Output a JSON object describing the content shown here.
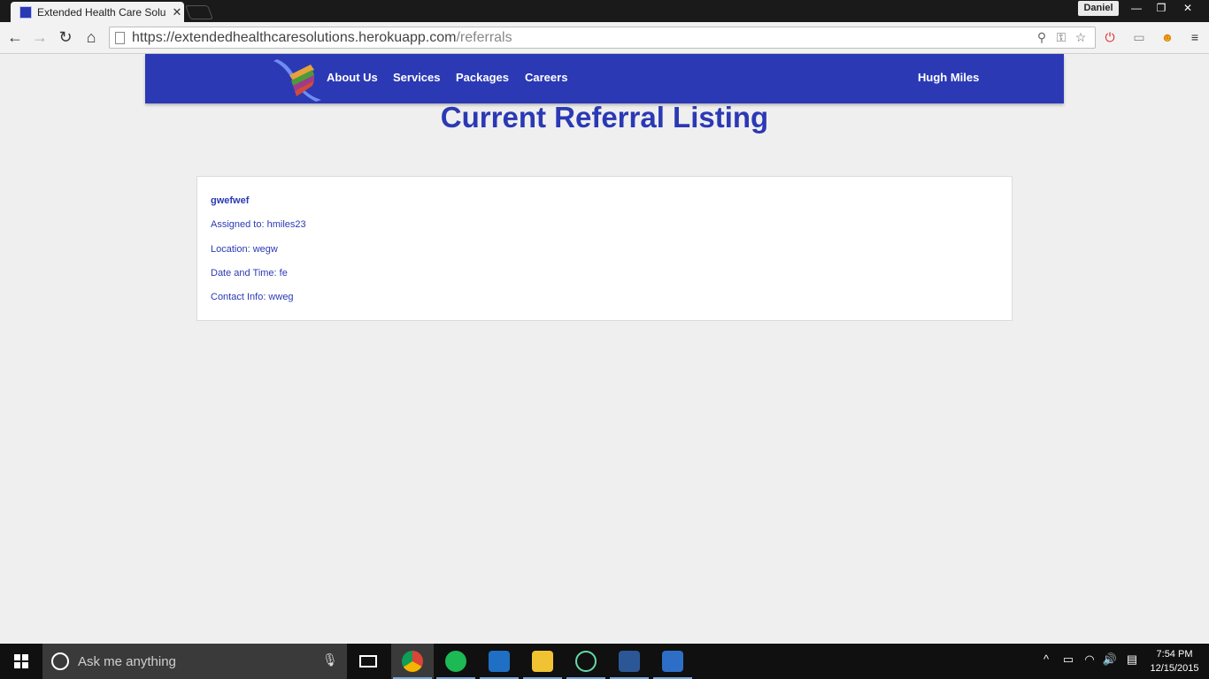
{
  "browser": {
    "tab_title": "Extended Health Care Solu",
    "profile_name": "Daniel",
    "url_host": "https://extendedhealthcaresolutions.herokuapp.com",
    "url_path": "/referrals"
  },
  "site": {
    "nav": [
      "About Us",
      "Services",
      "Packages",
      "Careers"
    ],
    "user_name": "Hugh Miles",
    "brand_color": "#2b39b5"
  },
  "page": {
    "title": "Current Referral Listing"
  },
  "referral": {
    "name": "gwefwef",
    "assigned": "Assigned to: hmiles23",
    "location": "Location: wegw",
    "datetime": "Date and Time: fe",
    "contact": "Contact Info: wweg"
  },
  "taskbar": {
    "search_placeholder": "Ask me anything",
    "time": "7:54 PM",
    "date": "12/15/2015"
  }
}
